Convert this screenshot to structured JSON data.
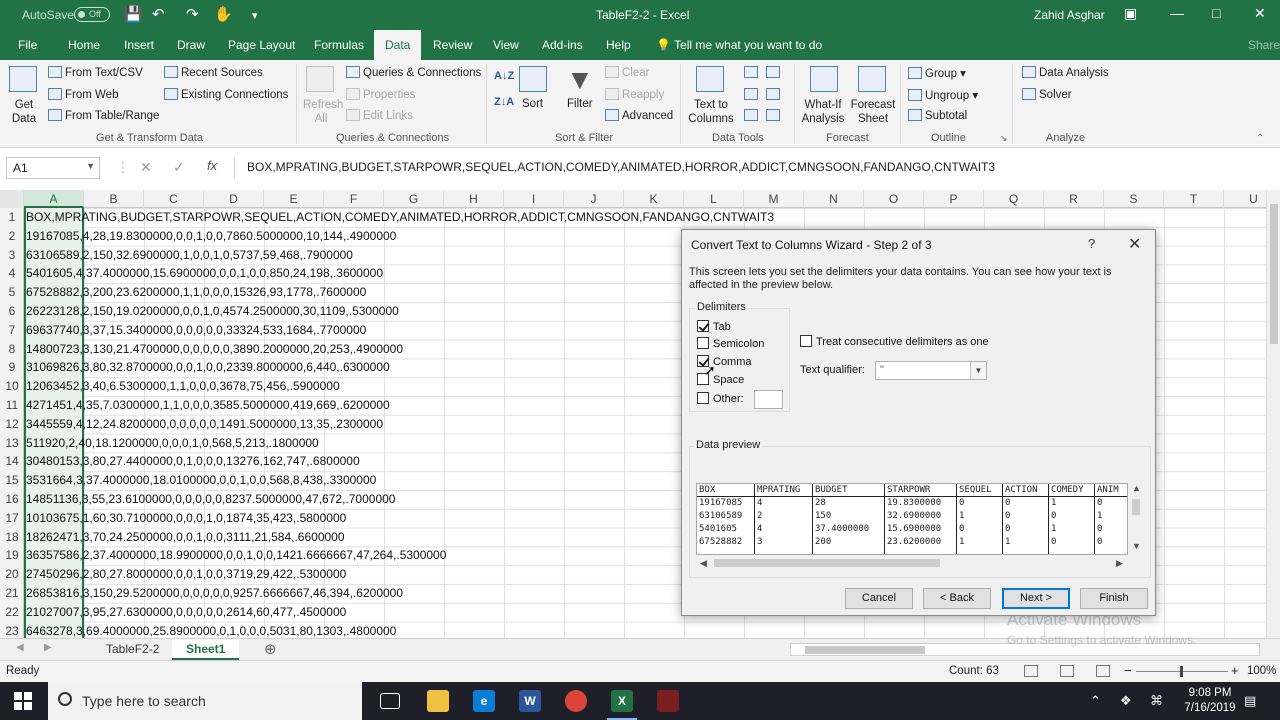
{
  "titlebar": {
    "autosave": "AutoSave",
    "autosave_state": "Off",
    "doc_title": "TableF2-2  -  Excel",
    "user": "Zahid Asghar"
  },
  "tabs": [
    "File",
    "Home",
    "Insert",
    "Draw",
    "Page Layout",
    "Formulas",
    "Data",
    "Review",
    "View",
    "Add-ins",
    "Help"
  ],
  "active_tab": "Data",
  "tell_me": "Tell me what you want to do",
  "share": "Share",
  "ribbon": {
    "get_data": "Get Data",
    "from_text_csv": "From Text/CSV",
    "from_web": "From Web",
    "from_table": "From Table/Range",
    "recent_sources": "Recent Sources",
    "existing_connections": "Existing Connections",
    "group_get_transform": "Get & Transform Data",
    "refresh_all": "Refresh All",
    "queries_connections": "Queries & Connections",
    "properties": "Properties",
    "edit_links": "Edit Links",
    "group_queries": "Queries & Connections",
    "sort": "Sort",
    "filter": "Filter",
    "clear": "Clear",
    "reapply": "Reapply",
    "advanced": "Advanced",
    "group_sort_filter": "Sort & Filter",
    "text_to_columns": "Text to Columns",
    "group_data_tools": "Data Tools",
    "what_if": "What-If Analysis",
    "forecast_sheet": "Forecast Sheet",
    "group_forecast": "Forecast",
    "group": "Group",
    "ungroup": "Ungroup",
    "subtotal": "Subtotal",
    "group_outline": "Outline",
    "data_analysis": "Data Analysis",
    "solver": "Solver",
    "group_analyze": "Analyze"
  },
  "formula_bar": {
    "name_box": "A1",
    "fx": "fx",
    "formula": "BOX,MPRATING,BUDGET,STARPOWR,SEQUEL,ACTION,COMEDY,ANIMATED,HORROR,ADDICT,CMNGSOON,FANDANGO,CNTWAIT3"
  },
  "columns": [
    "A",
    "B",
    "C",
    "D",
    "E",
    "F",
    "G",
    "H",
    "I",
    "J",
    "K",
    "L",
    "M",
    "N",
    "O",
    "P",
    "Q",
    "R",
    "S",
    "T",
    "U"
  ],
  "rows": [
    {
      "n": "1",
      "text": "BOX,MPRATING,BUDGET,STARPOWR,SEQUEL,ACTION,COMEDY,ANIMATED,HORROR,ADDICT,CMNGSOON,FANDANGO,CNTWAIT3"
    },
    {
      "n": "2",
      "text": "19167085,4,28,19.8300000,0,0,1,0,0,7860.5000000,10,144,.4900000"
    },
    {
      "n": "3",
      "text": "63106589,2,150,32.6900000,1,0,0,1,0,5737,59,468,.7900000"
    },
    {
      "n": "4",
      "text": "5401605,4,37.4000000,15.6900000,0,0,1,0,0,850,24,198,.3600000"
    },
    {
      "n": "5",
      "text": "67528882,3,200,23.6200000,1,1,0,0,0,15326,93,1778,.7600000"
    },
    {
      "n": "6",
      "text": "26223128,2,150,19.0200000,0,0,1,0,4574.2500000,30,1109,.5300000"
    },
    {
      "n": "7",
      "text": "69637740,3,37,15.3400000,0,0,0,0,0,33324,533,1684,.7700000"
    },
    {
      "n": "8",
      "text": "14800723,3,130,21.4700000,0,0,0,0,0,3890.2000000,20,253,.4900000"
    },
    {
      "n": "9",
      "text": "31069826,3,80,32.8700000,0,0,1,0,0,2339.8000000,6,440,.6300000"
    },
    {
      "n": "10",
      "text": "12063452,3,40,6.5300000,1,1,0,0,0,3678,75,456,.5900000"
    },
    {
      "n": "11",
      "text": "4271451,4,35,7.0300000,1,1,0,0,0,3585.5000000,419,669,.6200000"
    },
    {
      "n": "12",
      "text": "3445559,4,12,24.8200000,0,0,0,0,0,1491.5000000,13,35,.2300000"
    },
    {
      "n": "13",
      "text": "511920,2,40,18.1200000,0,0,0,1,0,568,5,213,.1800000"
    },
    {
      "n": "14",
      "text": "30480153,3,80,27.4400000,0,1,0,0,0,13276,162,747,.6800000"
    },
    {
      "n": "15",
      "text": "3531664,3,37.4000000,18.0100000,0,0,1,0,0,568,8,438,.3300000"
    },
    {
      "n": "16",
      "text": "14851136,3,55,23.6100000,0,0,0,0,0,8237.5000000,47,672,.7000000"
    },
    {
      "n": "17",
      "text": "10103675,1,60,30.7100000,0,0,0,1,0,1874,35,423,.5800000"
    },
    {
      "n": "18",
      "text": "18262471,3,70,24.2500000,0,0,1,0,0,3111,21,584,.6600000"
    },
    {
      "n": "19",
      "text": "36357586,2,37.4000000,18.9900000,0,0,1,0,0,1421.6666667,47,264,.5300000"
    },
    {
      "n": "20",
      "text": "27450296,2,80,27.8000000,0,0,1,0,0,3719,29,422,.5300000"
    },
    {
      "n": "21",
      "text": "26853816,3,150,29.5200000,0,0,0,0,0,9257.6666667,46,394,.6200000"
    },
    {
      "n": "22",
      "text": "21027007,3,95,27.6300000,0,0,0,0,0,2614,60,477,.4500000"
    },
    {
      "n": "23",
      "text": "6463278,3,69.4000000,25.8900000,0,1,0,0,0,5031,80,1303,.4800000"
    }
  ],
  "sheets": [
    "TableF2-2",
    "Sheet1"
  ],
  "active_sheet": "Sheet1",
  "status": {
    "ready": "Ready",
    "count": "Count: 63",
    "zoom": "100%"
  },
  "dialog": {
    "title": "Convert Text to Columns Wizard - Step 2 of 3",
    "help": "?",
    "description": "This screen lets you set the delimiters your data contains.  You can see how your text is affected in the preview below.",
    "delimiters_label": "Delimiters",
    "tab_label": "Tab",
    "tab_checked": true,
    "semicolon_label": "Semicolon",
    "semicolon_checked": false,
    "comma_label": "Comma",
    "comma_checked": true,
    "space_label": "Space",
    "space_checked": false,
    "other_label": "Other:",
    "other_checked": false,
    "other_value": "",
    "consecutive_label": "Treat consecutive delimiters as one",
    "consecutive_checked": false,
    "qualifier_label": "Text qualifier:",
    "qualifier_value": "\"",
    "data_preview_label": "Data preview",
    "preview_columns": [
      {
        "header": "BOX",
        "values": [
          "19167085",
          "63106589",
          "5401605",
          "67528882"
        ]
      },
      {
        "header": "MPRATING",
        "values": [
          "4",
          "2",
          "4",
          "3"
        ]
      },
      {
        "header": "BUDGET",
        "values": [
          "28",
          "150",
          "37.4000000",
          "200"
        ]
      },
      {
        "header": "STARPOWR",
        "values": [
          "19.8300000",
          "32.6900000",
          "15.6900000",
          "23.6200000"
        ]
      },
      {
        "header": "SEQUEL",
        "values": [
          "0",
          "1",
          "0",
          "1"
        ]
      },
      {
        "header": "ACTION",
        "values": [
          "0",
          "0",
          "0",
          "1"
        ]
      },
      {
        "header": "COMEDY",
        "values": [
          "1",
          "0",
          "1",
          "0"
        ]
      },
      {
        "header": "ANIM",
        "values": [
          "0",
          "1",
          "0",
          "0"
        ]
      }
    ],
    "buttons": {
      "cancel": "Cancel",
      "back": "< Back",
      "next": "Next >",
      "finish": "Finish"
    }
  },
  "watermark": {
    "line1": "Activate Windows",
    "line2": "Go to Settings to activate Windows."
  },
  "taskbar": {
    "search": "Type here to search",
    "time": "9:08 PM",
    "date": "7/16/2019"
  }
}
